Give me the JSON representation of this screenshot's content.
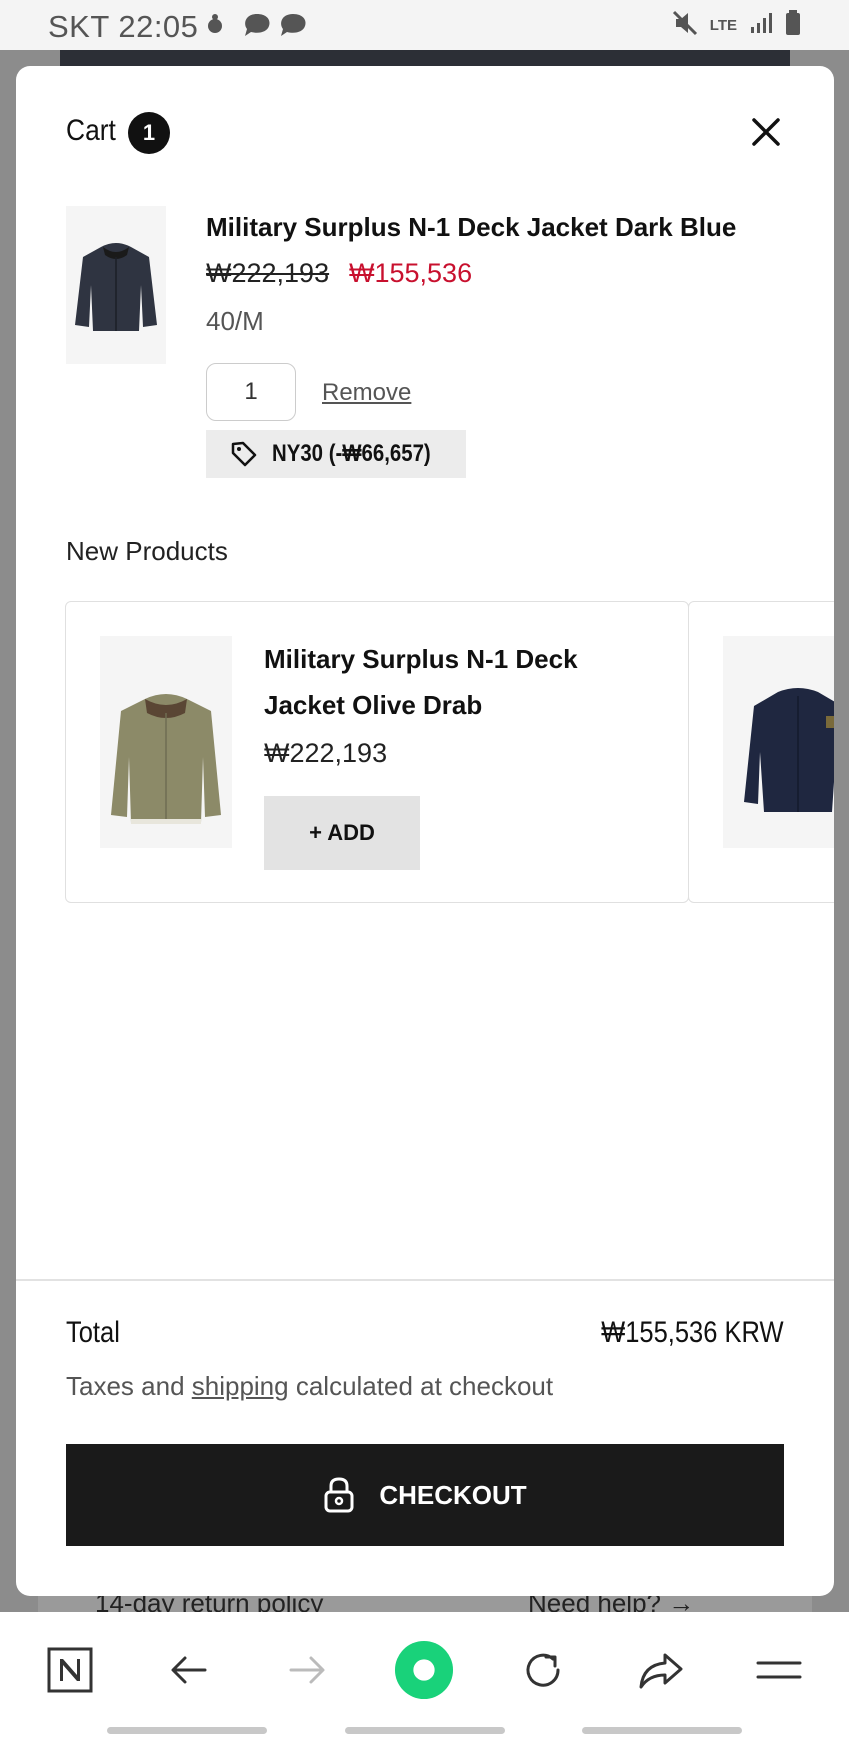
{
  "status_bar": {
    "carrier_time": "SKT 22:05",
    "network": "LTE"
  },
  "cart": {
    "title": "Cart",
    "count": "1",
    "item": {
      "name": "Military Surplus N-1 Deck Jacket Dark Blue",
      "original_price": "₩222,193",
      "sale_price": "₩155,536",
      "variant": "40/M",
      "quantity": "1",
      "remove_label": "Remove",
      "discount_label": "NY30 (-₩66,657)"
    }
  },
  "new_products": {
    "title": "New Products",
    "items": [
      {
        "name": "Military Surplus N-1 Deck Jacket Olive Drab",
        "price": "₩222,193",
        "add_label": "+ ADD"
      }
    ]
  },
  "footer": {
    "total_label": "Total",
    "total_value": "₩155,536 KRW",
    "tax_prefix": "Taxes and ",
    "tax_link": "shipping",
    "tax_suffix": " calculated at checkout",
    "checkout_label": "CHECKOUT"
  },
  "behind_modal": {
    "return_policy": "14-day return policy",
    "need_help": "Need help? →"
  },
  "colors": {
    "sale_red": "#c8102e",
    "checkout_bg": "#1a1a1a",
    "browser_green": "#19d27a"
  }
}
